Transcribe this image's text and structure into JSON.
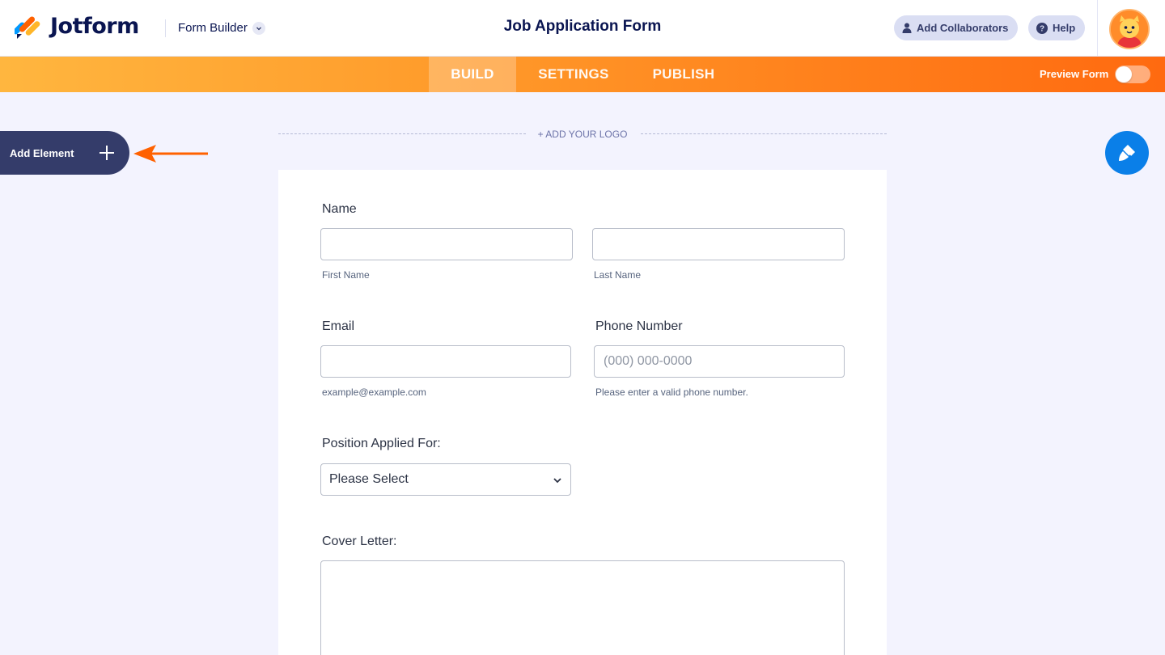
{
  "header": {
    "brand": "Jotform",
    "builder_label": "Form Builder",
    "form_title": "Job Application Form",
    "add_collaborators": "Add Collaborators",
    "help": "Help"
  },
  "nav": {
    "tabs": [
      {
        "label": "BUILD",
        "active": true
      },
      {
        "label": "SETTINGS",
        "active": false
      },
      {
        "label": "PUBLISH",
        "active": false
      }
    ],
    "preview_label": "Preview Form",
    "preview_on": false
  },
  "sidebar": {
    "add_element": "Add Element"
  },
  "logo_area": {
    "add_logo": "+ ADD YOUR LOGO"
  },
  "form": {
    "name": {
      "label": "Name",
      "first_sublabel": "First Name",
      "last_sublabel": "Last Name"
    },
    "email": {
      "label": "Email",
      "sublabel": "example@example.com"
    },
    "phone": {
      "label": "Phone Number",
      "placeholder": "(000) 000-0000",
      "sublabel": "Please enter a valid phone number."
    },
    "position": {
      "label": "Position Applied For:",
      "selected": "Please Select"
    },
    "cover_letter": {
      "label": "Cover Letter:"
    }
  },
  "colors": {
    "navy": "#0a1551",
    "orange": "#ff7d1a",
    "brush_blue": "#0a7fe8",
    "add_element_bg": "#343c6a",
    "arrow": "#ff6100"
  },
  "icons": {
    "user": "user-icon",
    "help": "question-circle-icon",
    "brush": "paint-brush-icon",
    "plus": "plus-icon",
    "chevron": "chevron-down-icon"
  }
}
